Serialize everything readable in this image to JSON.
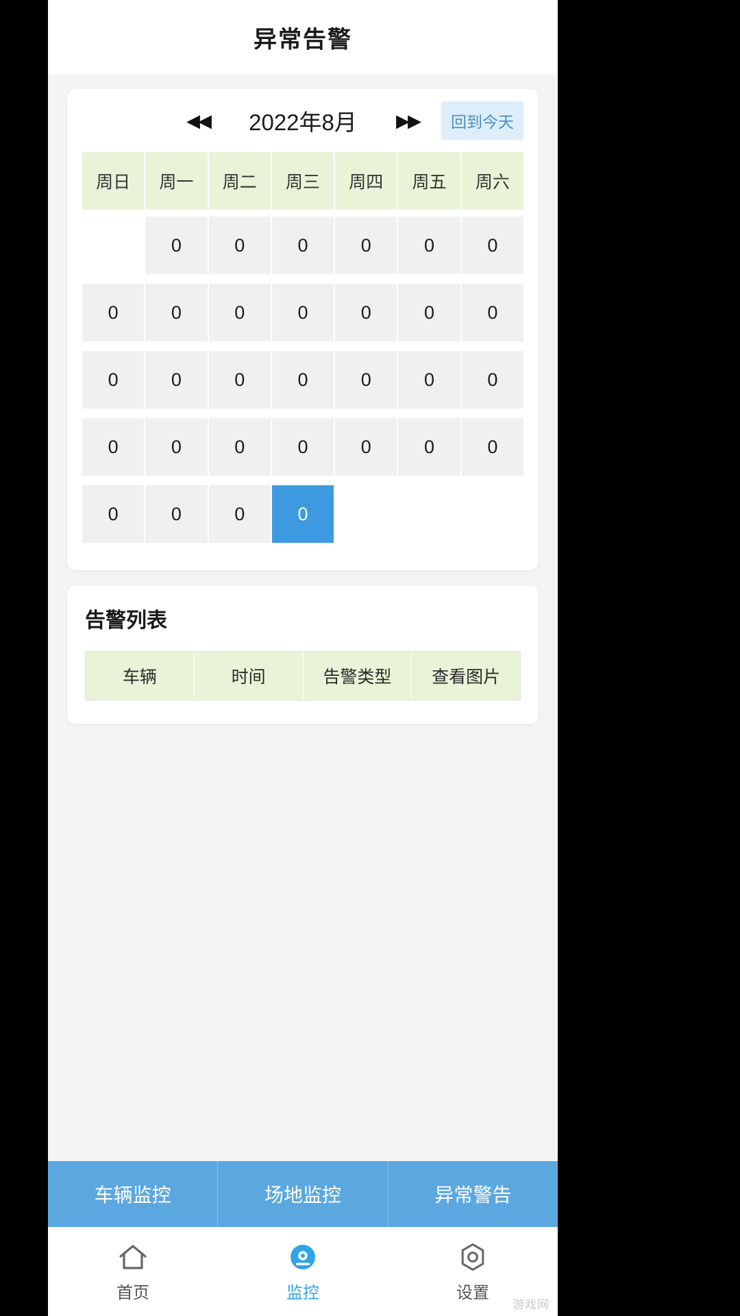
{
  "header": {
    "title": "异常告警"
  },
  "calendar": {
    "prev_icon": "◀◀",
    "next_icon": "▶▶",
    "month_label": "2022年8月",
    "today_button": "回到今天",
    "weekdays": [
      "周日",
      "周一",
      "周二",
      "周三",
      "周四",
      "周五",
      "周六"
    ],
    "weeks": [
      {
        "cells": [
          {
            "value": "",
            "empty": true,
            "selected": false
          },
          {
            "value": "0",
            "empty": false,
            "selected": false
          },
          {
            "value": "0",
            "empty": false,
            "selected": false
          },
          {
            "value": "0",
            "empty": false,
            "selected": false
          },
          {
            "value": "0",
            "empty": false,
            "selected": false
          },
          {
            "value": "0",
            "empty": false,
            "selected": false
          },
          {
            "value": "0",
            "empty": false,
            "selected": false
          }
        ]
      },
      {
        "cells": [
          {
            "value": "0",
            "empty": false,
            "selected": false
          },
          {
            "value": "0",
            "empty": false,
            "selected": false
          },
          {
            "value": "0",
            "empty": false,
            "selected": false
          },
          {
            "value": "0",
            "empty": false,
            "selected": false
          },
          {
            "value": "0",
            "empty": false,
            "selected": false
          },
          {
            "value": "0",
            "empty": false,
            "selected": false
          },
          {
            "value": "0",
            "empty": false,
            "selected": false
          }
        ]
      },
      {
        "cells": [
          {
            "value": "0",
            "empty": false,
            "selected": false
          },
          {
            "value": "0",
            "empty": false,
            "selected": false
          },
          {
            "value": "0",
            "empty": false,
            "selected": false
          },
          {
            "value": "0",
            "empty": false,
            "selected": false
          },
          {
            "value": "0",
            "empty": false,
            "selected": false
          },
          {
            "value": "0",
            "empty": false,
            "selected": false
          },
          {
            "value": "0",
            "empty": false,
            "selected": false
          }
        ]
      },
      {
        "cells": [
          {
            "value": "0",
            "empty": false,
            "selected": false
          },
          {
            "value": "0",
            "empty": false,
            "selected": false
          },
          {
            "value": "0",
            "empty": false,
            "selected": false
          },
          {
            "value": "0",
            "empty": false,
            "selected": false
          },
          {
            "value": "0",
            "empty": false,
            "selected": false
          },
          {
            "value": "0",
            "empty": false,
            "selected": false
          },
          {
            "value": "0",
            "empty": false,
            "selected": false
          }
        ]
      },
      {
        "cells": [
          {
            "value": "0",
            "empty": false,
            "selected": false
          },
          {
            "value": "0",
            "empty": false,
            "selected": false
          },
          {
            "value": "0",
            "empty": false,
            "selected": false
          },
          {
            "value": "0",
            "empty": false,
            "selected": true
          },
          {
            "value": "",
            "empty": true,
            "selected": false
          },
          {
            "value": "",
            "empty": true,
            "selected": false
          },
          {
            "value": "",
            "empty": true,
            "selected": false
          }
        ]
      }
    ]
  },
  "alert_list": {
    "title": "告警列表",
    "columns": [
      "车辆",
      "时间",
      "告警类型",
      "查看图片"
    ],
    "rows": []
  },
  "tabs": [
    {
      "label": "车辆监控",
      "active": false
    },
    {
      "label": "场地监控",
      "active": false
    },
    {
      "label": "异常警告",
      "active": false
    }
  ],
  "bottom_nav": [
    {
      "label": "首页",
      "icon": "home-icon",
      "active": false
    },
    {
      "label": "监控",
      "icon": "camera-icon",
      "active": true
    },
    {
      "label": "设置",
      "icon": "gear-icon",
      "active": false
    }
  ],
  "colors": {
    "accent_blue": "#3d9ae0",
    "tabbar_blue": "#5ba8e0",
    "header_green": "#e9f3d7",
    "today_btn_bg": "#ddeefa",
    "today_btn_text": "#4a90c4",
    "cell_gray": "#f0f0f0"
  },
  "watermark": "游戏网"
}
